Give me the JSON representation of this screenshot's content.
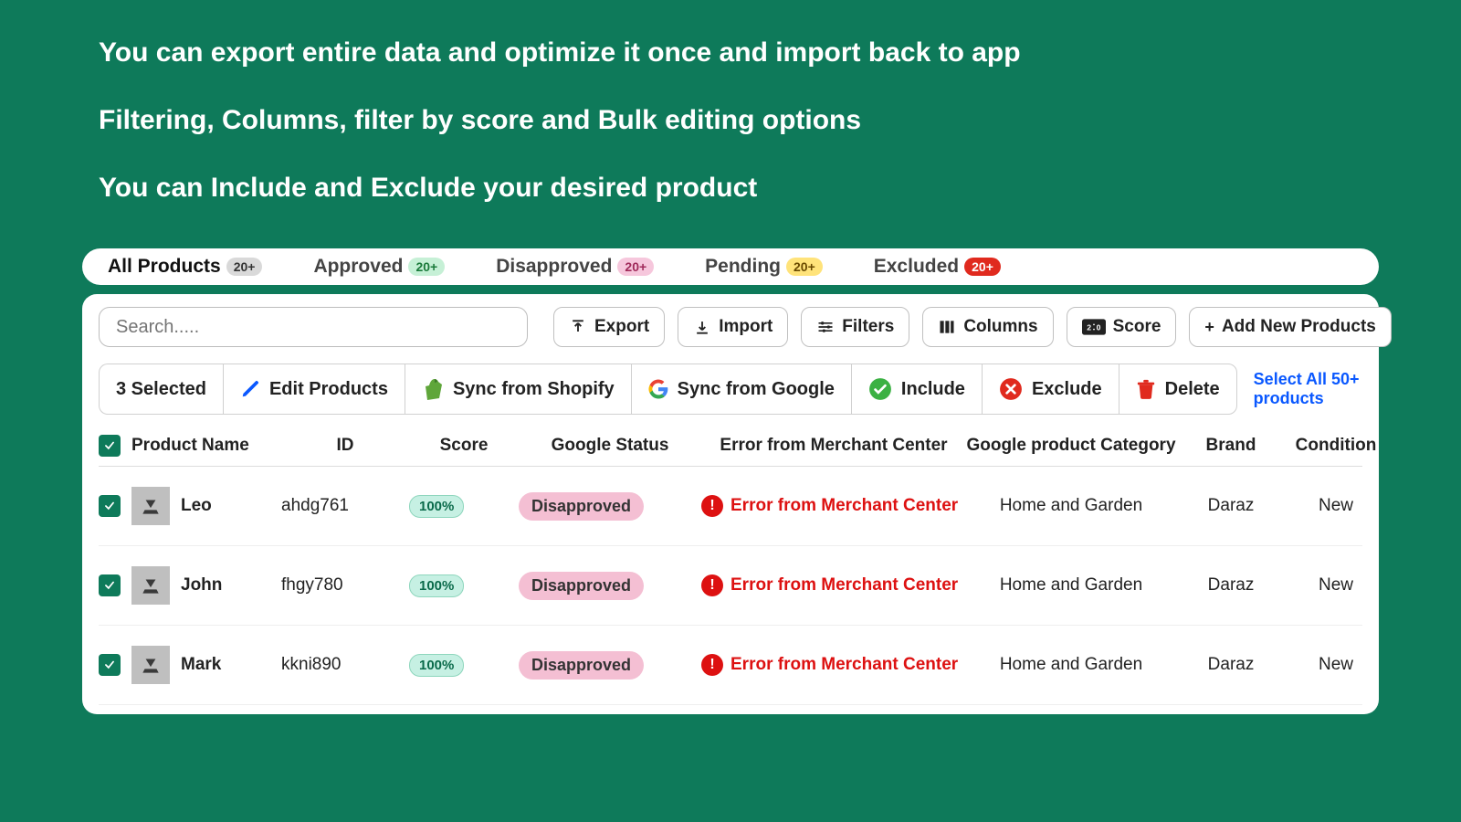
{
  "headlines": {
    "l1": "You can export entire data and optimize it once and import back to app",
    "l2": "Filtering, Columns, filter by score and Bulk editing options",
    "l3": "You can Include and Exclude your desired product"
  },
  "tabs": {
    "all": {
      "label": "All Products",
      "count": "20+"
    },
    "approved": {
      "label": "Approved",
      "count": "20+"
    },
    "disapproved": {
      "label": "Disapproved",
      "count": "20+"
    },
    "pending": {
      "label": "Pending",
      "count": "20+"
    },
    "excluded": {
      "label": "Excluded",
      "count": "20+"
    }
  },
  "search": {
    "placeholder": "Search....."
  },
  "toolbar": {
    "export": "Export",
    "import": "Import",
    "filters": "Filters",
    "columns": "Columns",
    "score": "Score",
    "add_new": "Add New Products"
  },
  "selection": {
    "count_label": "3 Selected",
    "edit": "Edit Products",
    "sync_shopify": "Sync from Shopify",
    "sync_google": "Sync from Google",
    "include": "Include",
    "exclude": "Exclude",
    "delete": "Delete",
    "select_all": "Select All 50+ products"
  },
  "columns_head": {
    "name": "Product Name",
    "id": "ID",
    "score": "Score",
    "gstatus": "Google Status",
    "error": "Error from Merchant Center",
    "gcat": "Google product Category",
    "brand": "Brand",
    "condition": "Condition"
  },
  "rows": [
    {
      "name": "Leo",
      "id": "ahdg761",
      "score": "100%",
      "gstatus": "Disapproved",
      "error": "Error from Merchant Center",
      "gcat": "Home and Garden",
      "brand": "Daraz",
      "condition": "New"
    },
    {
      "name": "John",
      "id": "fhgy780",
      "score": "100%",
      "gstatus": "Disapproved",
      "error": "Error from Merchant Center",
      "gcat": "Home and Garden",
      "brand": "Daraz",
      "condition": "New"
    },
    {
      "name": "Mark",
      "id": "kkni890",
      "score": "100%",
      "gstatus": "Disapproved",
      "error": "Error from Merchant Center",
      "gcat": "Home and Garden",
      "brand": "Daraz",
      "condition": "New"
    }
  ]
}
